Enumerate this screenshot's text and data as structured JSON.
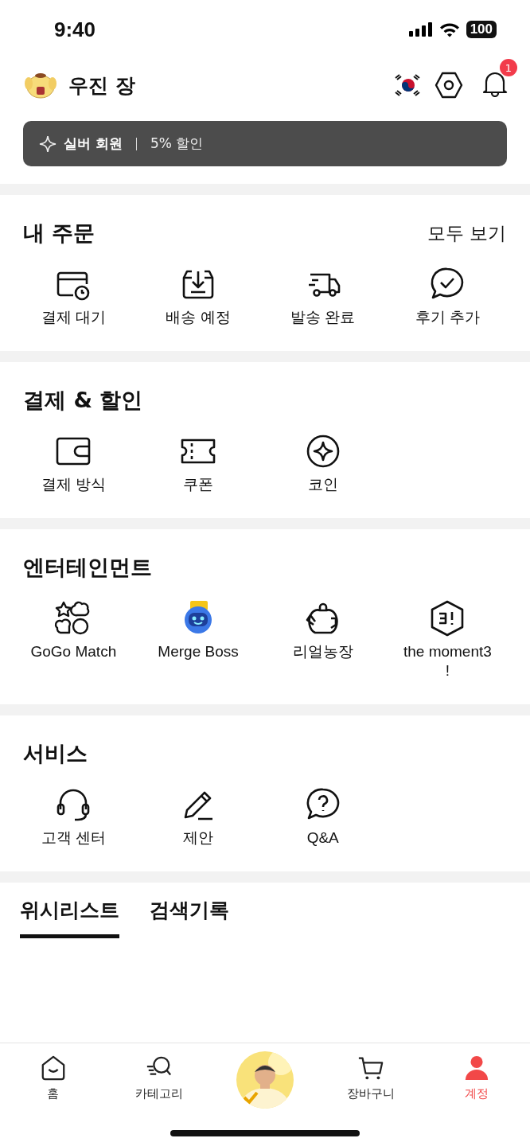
{
  "status_bar": {
    "time": "9:40",
    "battery": "100"
  },
  "header": {
    "name": "우진 장",
    "notifications": "1"
  },
  "membership": {
    "tier": "실버 회원",
    "discount": "5% 할인"
  },
  "sections": [
    {
      "title": "내 주문",
      "action": "모두 보기",
      "items": [
        {
          "label": "결제 대기"
        },
        {
          "label": "배송 예정"
        },
        {
          "label": "발송 완료"
        },
        {
          "label": "후기 추가"
        }
      ]
    },
    {
      "title": "결제 & 할인",
      "items": [
        {
          "label": "결제 방식"
        },
        {
          "label": "쿠폰"
        },
        {
          "label": "코인"
        }
      ]
    },
    {
      "title": "엔터테인먼트",
      "items": [
        {
          "label": "GoGo Match"
        },
        {
          "label": "Merge Boss"
        },
        {
          "label": "리얼농장"
        },
        {
          "label": "the moment3 !"
        }
      ]
    },
    {
      "title": "서비스",
      "items": [
        {
          "label": "고객 센터"
        },
        {
          "label": "제안"
        },
        {
          "label": "Q&A"
        }
      ]
    }
  ],
  "tabs": [
    {
      "label": "위시리스트",
      "selected": true
    },
    {
      "label": "검색기록",
      "selected": false
    }
  ],
  "nav": [
    {
      "label": "홈",
      "selected": false
    },
    {
      "label": "카테고리",
      "selected": false
    },
    {
      "kind": "picture"
    },
    {
      "label": "장바구니",
      "selected": false
    },
    {
      "label": "계정",
      "selected": true
    }
  ]
}
